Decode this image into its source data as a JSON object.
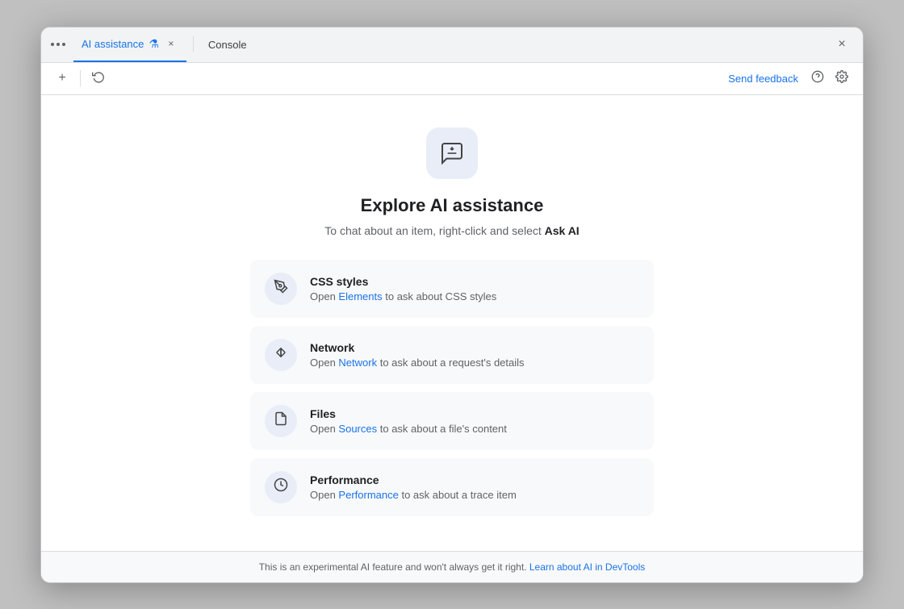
{
  "titlebar": {
    "tab_active_label": "AI assistance",
    "tab_inactive_label": "Console",
    "close_label": "×"
  },
  "toolbar": {
    "add_label": "+",
    "history_icon": "history-icon",
    "send_feedback_label": "Send feedback",
    "help_icon": "help-icon",
    "settings_icon": "settings-icon"
  },
  "main": {
    "icon": "ai-chat-icon",
    "title": "Explore AI assistance",
    "subtitle_text": "To chat about an item, right-click and select ",
    "subtitle_bold": "Ask AI",
    "features": [
      {
        "id": "css",
        "title": "CSS styles",
        "desc_before": "Open ",
        "link_label": "Elements",
        "desc_after": " to ask about CSS styles"
      },
      {
        "id": "network",
        "title": "Network",
        "desc_before": "Open ",
        "link_label": "Network",
        "desc_after": " to ask about a request's details"
      },
      {
        "id": "files",
        "title": "Files",
        "desc_before": "Open ",
        "link_label": "Sources",
        "desc_after": " to ask about a file's content"
      },
      {
        "id": "performance",
        "title": "Performance",
        "desc_before": "Open ",
        "link_label": "Performance",
        "desc_after": " to ask about a trace item"
      }
    ]
  },
  "footer": {
    "text": "This is an experimental AI feature and won't always get it right. ",
    "link_label": "Learn about AI in DevTools"
  },
  "colors": {
    "accent": "#1a73e8",
    "tab_active": "#1a73e8"
  }
}
